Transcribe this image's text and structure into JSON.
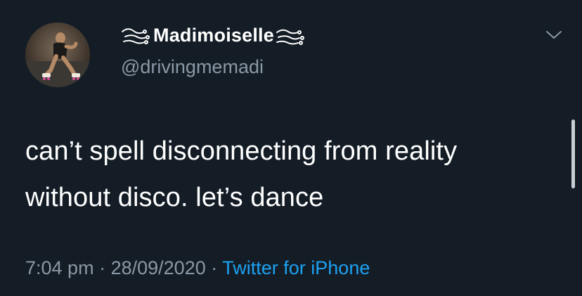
{
  "tweet": {
    "display_name": "Madimoiselle",
    "handle": "@drivingmemadi",
    "text_line_1": "can’t spell disconnecting from reality",
    "text_line_2": "without disco. let’s dance",
    "time": "7:04 pm",
    "separator": "·",
    "date": "28/09/2020",
    "source": "Twitter for iPhone"
  },
  "icons": {
    "avatar": "avatar-photo-roller-skater",
    "name_decoration_left": "swirl-ornament-icon",
    "name_decoration_right": "swirl-ornament-icon",
    "menu": "chevron-down-icon"
  },
  "colors": {
    "background": "#141d26",
    "primary_text": "#ffffff",
    "secondary_text": "#8b98a5",
    "link": "#1da1f2"
  }
}
